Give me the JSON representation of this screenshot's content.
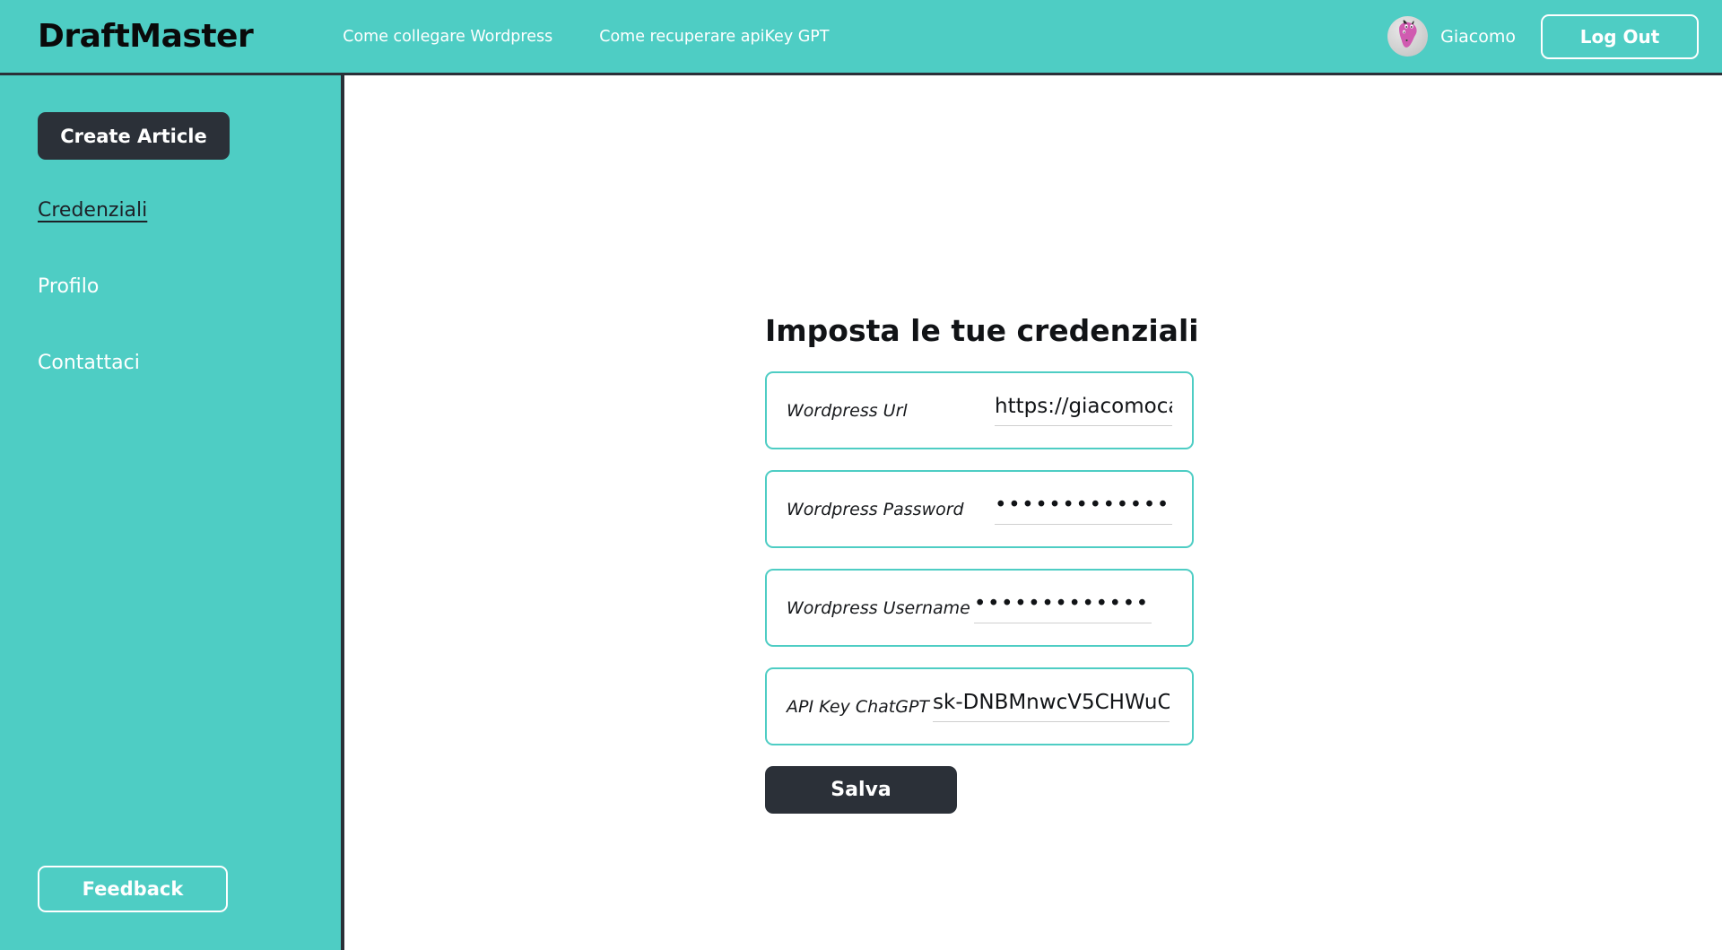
{
  "colors": {
    "brand_teal": "#4ecdc4",
    "dark": "#2b3038",
    "white": "#ffffff",
    "field_border": "#4ecdc4",
    "underline": "#cfcfcf"
  },
  "header": {
    "logo": "DraftMaster",
    "nav": [
      {
        "label": "Come collegare Wordpress"
      },
      {
        "label": "Come recuperare apiKey GPT"
      }
    ],
    "avatar_icon": "user-avatar-cartoon",
    "user_name": "Giacomo",
    "logout_label": "Log Out"
  },
  "sidebar": {
    "create_article_label": "Create Article",
    "items": [
      {
        "label": "Credenziali",
        "active": true
      },
      {
        "label": "Profilo",
        "active": false
      },
      {
        "label": "Contattaci",
        "active": false
      }
    ],
    "feedback_label": "Feedback"
  },
  "main": {
    "title": "Imposta le tue credenziali",
    "fields": [
      {
        "label": "Wordpress Url",
        "value": "https://giacomocasolo.i",
        "masked": false
      },
      {
        "label": "Wordpress Password",
        "value": "••••••••••••••••••••••••••••",
        "masked": true
      },
      {
        "label": "Wordpress Username",
        "value": "•••••••••••••",
        "masked": true
      },
      {
        "label": "API Key ChatGPT",
        "value": "sk-DNBMnwcV5CHWuC",
        "masked": false
      }
    ],
    "save_label": "Salva"
  }
}
